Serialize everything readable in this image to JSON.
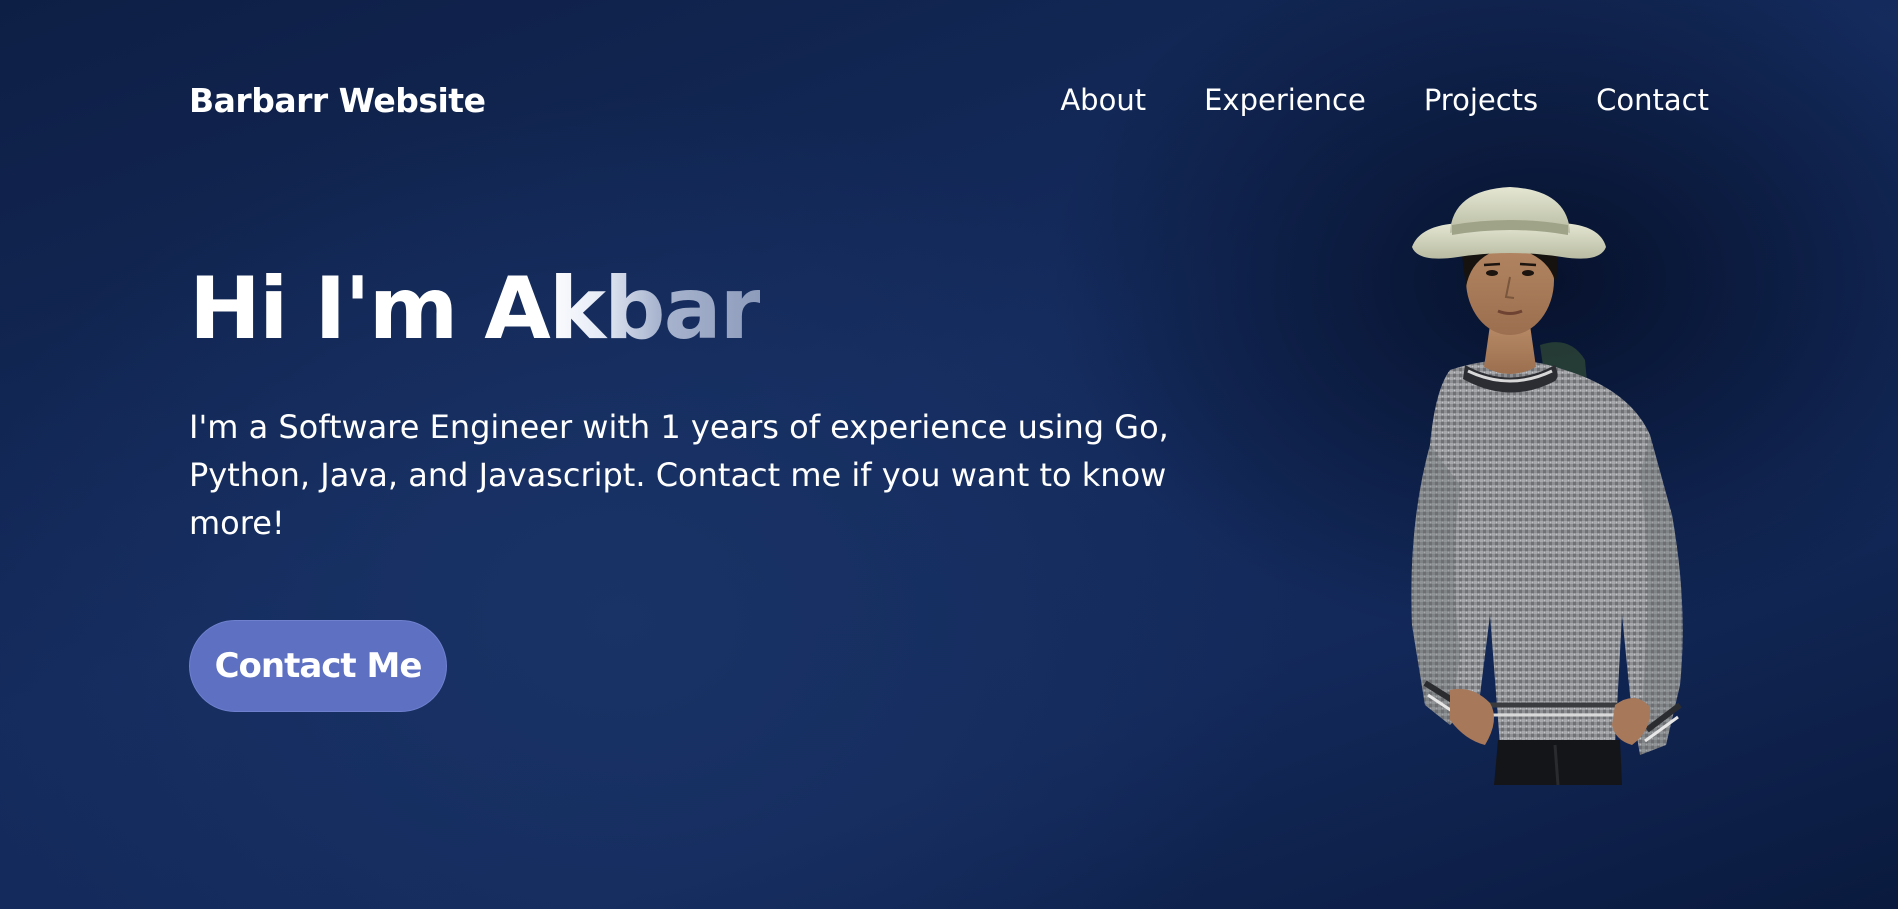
{
  "navbar": {
    "brand": "Barbarr Website",
    "links": [
      {
        "label": "About"
      },
      {
        "label": "Experience"
      },
      {
        "label": "Projects"
      },
      {
        "label": "Contact"
      }
    ]
  },
  "hero": {
    "title": "Hi I'm Akbar",
    "description": "I'm a Software Engineer with 1 years of experience using Go, Python, Java, and Javascript. Contact me if you want to know more!",
    "cta_label": "Contact Me"
  },
  "portrait": {
    "alt": "Portrait of Akbar wearing a hat and grey sweater"
  },
  "colors": {
    "background": "#13295a",
    "button": "#5e70c2",
    "text": "#ffffff"
  }
}
